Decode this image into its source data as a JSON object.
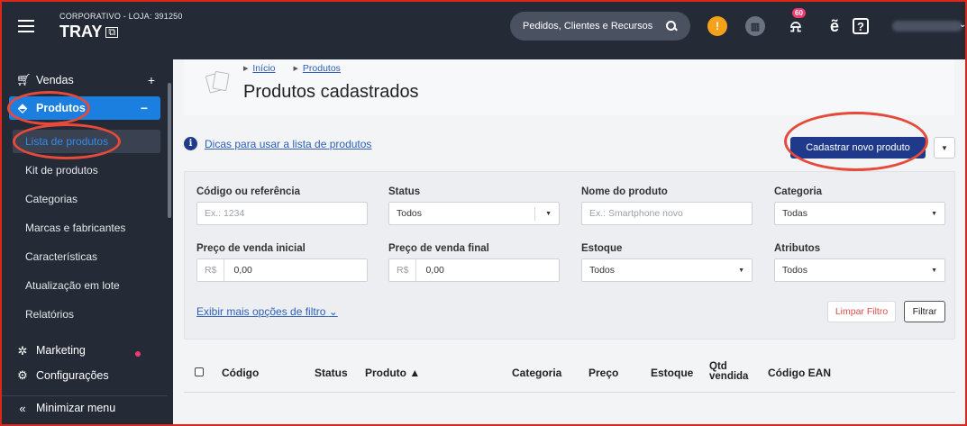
{
  "topbar": {
    "store_line": "CORPORATIVO - LOJA: 391250",
    "brand": "TRAY",
    "brand_ext_icon": "⧉",
    "search_placeholder": "Pedidos, Clientes e Recursos",
    "alert_glyph": "!",
    "bell_badge": "60",
    "icons": [
      "menu-icon",
      "search-icon",
      "alert-icon",
      "bank-icon",
      "bell-icon",
      "tray-icon",
      "help-icon",
      "chevron-down-icon"
    ]
  },
  "sidebar": {
    "vendas": {
      "label": "Vendas",
      "toggle": "+"
    },
    "produtos": {
      "label": "Produtos",
      "toggle": "−"
    },
    "sub_items": [
      "Lista de produtos",
      "Kit de produtos",
      "Categorias",
      "Marcas e fabricantes",
      "Características",
      "Atualização em lote",
      "Relatórios"
    ],
    "marketing": {
      "label": "Marketing"
    },
    "config": {
      "label": "Configurações"
    },
    "minimize": {
      "label": "Minimizar menu"
    }
  },
  "header": {
    "breadcrumb": [
      "Início",
      "Produtos"
    ],
    "title": "Produtos cadastrados"
  },
  "actions": {
    "tips_link": "Dicas para usar a lista de produtos",
    "new_product": "Cadastrar novo produto"
  },
  "filters": {
    "codigo": {
      "label": "Código ou referência",
      "placeholder": "Ex.: 1234"
    },
    "status": {
      "label": "Status",
      "value": "Todos"
    },
    "nome": {
      "label": "Nome do produto",
      "placeholder": "Ex.: Smartphone novo"
    },
    "categoria": {
      "label": "Categoria",
      "value": "Todas"
    },
    "preco_inicial": {
      "label": "Preço de venda inicial",
      "prefix": "R$",
      "value": "0,00"
    },
    "preco_final": {
      "label": "Preço de venda final",
      "prefix": "R$",
      "value": "0,00"
    },
    "estoque": {
      "label": "Estoque",
      "value": "Todos"
    },
    "atributos": {
      "label": "Atributos",
      "value": "Todos"
    },
    "more": "Exibir mais opções de filtro",
    "clear": "Limpar Filtro",
    "apply": "Filtrar"
  },
  "table": {
    "columns": {
      "codigo": "Código",
      "status": "Status",
      "produto": "Produto ▲",
      "categoria": "Categoria",
      "preco": "Preço",
      "estoque": "Estoque",
      "qtd_1": "Qtd",
      "qtd_2": "vendida",
      "ean": "Código EAN"
    }
  },
  "colors": {
    "sidebar_bg": "#242a36",
    "active_blue": "#1b7fe0",
    "primary_button": "#1f3a8a",
    "annotation_red": "#e54a3a"
  }
}
